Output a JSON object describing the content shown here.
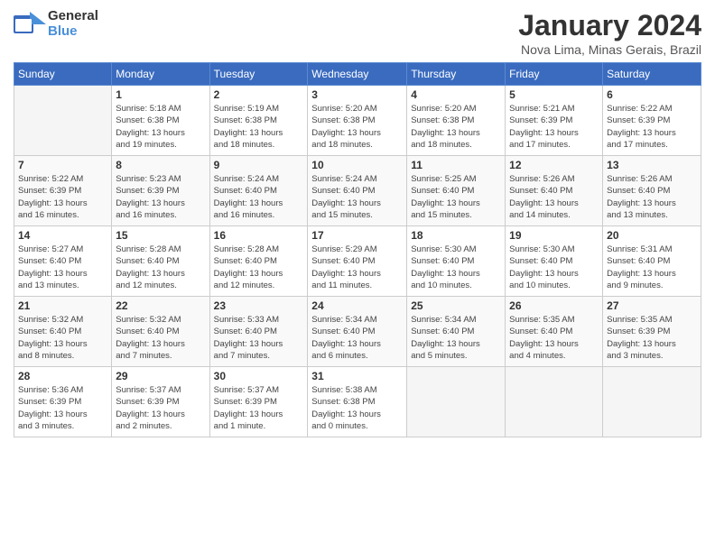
{
  "logo": {
    "general": "General",
    "blue": "Blue"
  },
  "header": {
    "title": "January 2024",
    "subtitle": "Nova Lima, Minas Gerais, Brazil"
  },
  "weekdays": [
    "Sunday",
    "Monday",
    "Tuesday",
    "Wednesday",
    "Thursday",
    "Friday",
    "Saturday"
  ],
  "weeks": [
    [
      {
        "day": "",
        "info": ""
      },
      {
        "day": "1",
        "info": "Sunrise: 5:18 AM\nSunset: 6:38 PM\nDaylight: 13 hours\nand 19 minutes."
      },
      {
        "day": "2",
        "info": "Sunrise: 5:19 AM\nSunset: 6:38 PM\nDaylight: 13 hours\nand 18 minutes."
      },
      {
        "day": "3",
        "info": "Sunrise: 5:20 AM\nSunset: 6:38 PM\nDaylight: 13 hours\nand 18 minutes."
      },
      {
        "day": "4",
        "info": "Sunrise: 5:20 AM\nSunset: 6:38 PM\nDaylight: 13 hours\nand 18 minutes."
      },
      {
        "day": "5",
        "info": "Sunrise: 5:21 AM\nSunset: 6:39 PM\nDaylight: 13 hours\nand 17 minutes."
      },
      {
        "day": "6",
        "info": "Sunrise: 5:22 AM\nSunset: 6:39 PM\nDaylight: 13 hours\nand 17 minutes."
      }
    ],
    [
      {
        "day": "7",
        "info": "Sunrise: 5:22 AM\nSunset: 6:39 PM\nDaylight: 13 hours\nand 16 minutes."
      },
      {
        "day": "8",
        "info": "Sunrise: 5:23 AM\nSunset: 6:39 PM\nDaylight: 13 hours\nand 16 minutes."
      },
      {
        "day": "9",
        "info": "Sunrise: 5:24 AM\nSunset: 6:40 PM\nDaylight: 13 hours\nand 16 minutes."
      },
      {
        "day": "10",
        "info": "Sunrise: 5:24 AM\nSunset: 6:40 PM\nDaylight: 13 hours\nand 15 minutes."
      },
      {
        "day": "11",
        "info": "Sunrise: 5:25 AM\nSunset: 6:40 PM\nDaylight: 13 hours\nand 15 minutes."
      },
      {
        "day": "12",
        "info": "Sunrise: 5:26 AM\nSunset: 6:40 PM\nDaylight: 13 hours\nand 14 minutes."
      },
      {
        "day": "13",
        "info": "Sunrise: 5:26 AM\nSunset: 6:40 PM\nDaylight: 13 hours\nand 13 minutes."
      }
    ],
    [
      {
        "day": "14",
        "info": "Sunrise: 5:27 AM\nSunset: 6:40 PM\nDaylight: 13 hours\nand 13 minutes."
      },
      {
        "day": "15",
        "info": "Sunrise: 5:28 AM\nSunset: 6:40 PM\nDaylight: 13 hours\nand 12 minutes."
      },
      {
        "day": "16",
        "info": "Sunrise: 5:28 AM\nSunset: 6:40 PM\nDaylight: 13 hours\nand 12 minutes."
      },
      {
        "day": "17",
        "info": "Sunrise: 5:29 AM\nSunset: 6:40 PM\nDaylight: 13 hours\nand 11 minutes."
      },
      {
        "day": "18",
        "info": "Sunrise: 5:30 AM\nSunset: 6:40 PM\nDaylight: 13 hours\nand 10 minutes."
      },
      {
        "day": "19",
        "info": "Sunrise: 5:30 AM\nSunset: 6:40 PM\nDaylight: 13 hours\nand 10 minutes."
      },
      {
        "day": "20",
        "info": "Sunrise: 5:31 AM\nSunset: 6:40 PM\nDaylight: 13 hours\nand 9 minutes."
      }
    ],
    [
      {
        "day": "21",
        "info": "Sunrise: 5:32 AM\nSunset: 6:40 PM\nDaylight: 13 hours\nand 8 minutes."
      },
      {
        "day": "22",
        "info": "Sunrise: 5:32 AM\nSunset: 6:40 PM\nDaylight: 13 hours\nand 7 minutes."
      },
      {
        "day": "23",
        "info": "Sunrise: 5:33 AM\nSunset: 6:40 PM\nDaylight: 13 hours\nand 7 minutes."
      },
      {
        "day": "24",
        "info": "Sunrise: 5:34 AM\nSunset: 6:40 PM\nDaylight: 13 hours\nand 6 minutes."
      },
      {
        "day": "25",
        "info": "Sunrise: 5:34 AM\nSunset: 6:40 PM\nDaylight: 13 hours\nand 5 minutes."
      },
      {
        "day": "26",
        "info": "Sunrise: 5:35 AM\nSunset: 6:40 PM\nDaylight: 13 hours\nand 4 minutes."
      },
      {
        "day": "27",
        "info": "Sunrise: 5:35 AM\nSunset: 6:39 PM\nDaylight: 13 hours\nand 3 minutes."
      }
    ],
    [
      {
        "day": "28",
        "info": "Sunrise: 5:36 AM\nSunset: 6:39 PM\nDaylight: 13 hours\nand 3 minutes."
      },
      {
        "day": "29",
        "info": "Sunrise: 5:37 AM\nSunset: 6:39 PM\nDaylight: 13 hours\nand 2 minutes."
      },
      {
        "day": "30",
        "info": "Sunrise: 5:37 AM\nSunset: 6:39 PM\nDaylight: 13 hours\nand 1 minute."
      },
      {
        "day": "31",
        "info": "Sunrise: 5:38 AM\nSunset: 6:38 PM\nDaylight: 13 hours\nand 0 minutes."
      },
      {
        "day": "",
        "info": ""
      },
      {
        "day": "",
        "info": ""
      },
      {
        "day": "",
        "info": ""
      }
    ]
  ]
}
